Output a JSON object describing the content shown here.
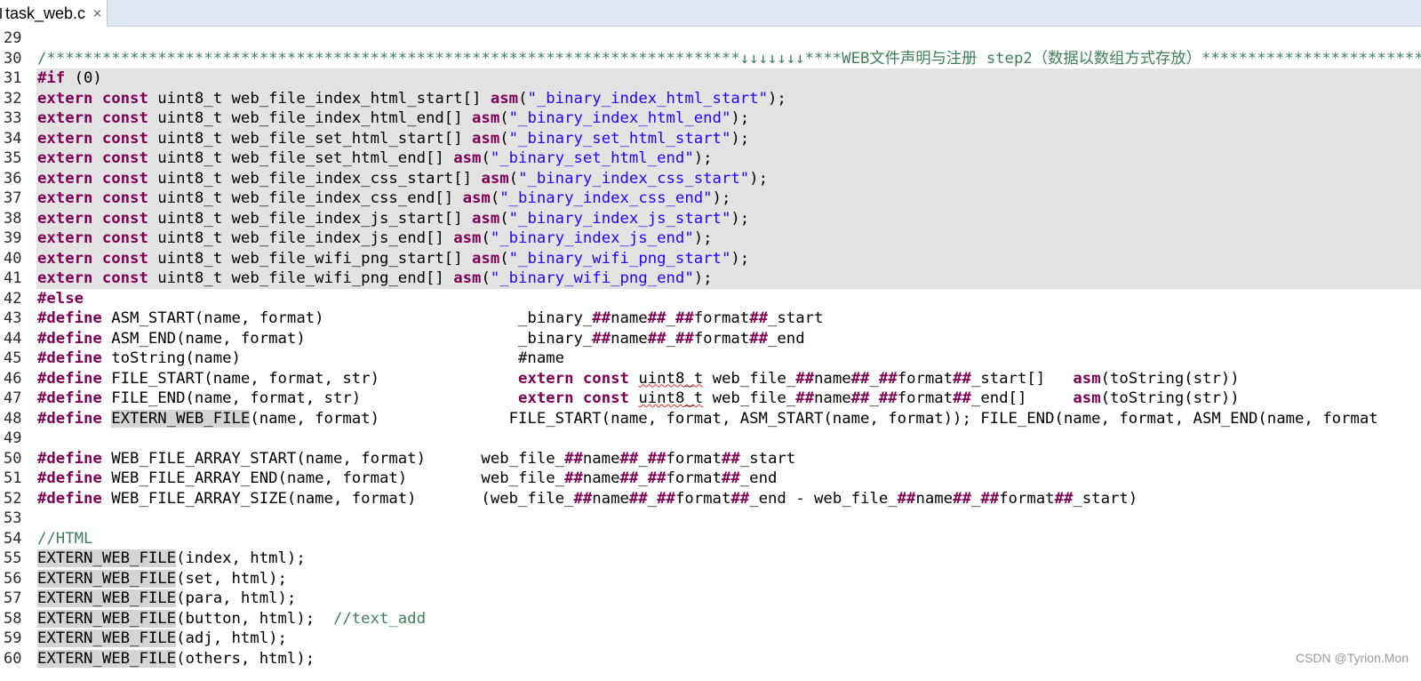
{
  "tab": {
    "title": "task_web.c",
    "close_glyph": "×"
  },
  "lines": [
    {
      "n": "29",
      "hl": false,
      "tokens": []
    },
    {
      "n": "30",
      "hl": false,
      "tokens": [
        {
          "t": "/***************************************************************************↓↓↓↓↓↓↓****WEB文件声明与注册 step2（数据以数组方式存放）******************************",
          "c": "cmt"
        }
      ]
    },
    {
      "n": "31",
      "hl": true,
      "tokens": [
        {
          "t": "#if",
          "c": "pp"
        },
        {
          "t": " (0)"
        }
      ]
    },
    {
      "n": "32",
      "hl": true,
      "tokens": [
        {
          "t": "extern",
          "c": "kw"
        },
        {
          "t": " "
        },
        {
          "t": "const",
          "c": "kw"
        },
        {
          "t": " uint8_t web_file_index_html_start[] "
        },
        {
          "t": "asm",
          "c": "kw"
        },
        {
          "t": "("
        },
        {
          "t": "\"_binary_index_html_start\"",
          "c": "str"
        },
        {
          "t": ");"
        }
      ]
    },
    {
      "n": "33",
      "hl": true,
      "tokens": [
        {
          "t": "extern",
          "c": "kw"
        },
        {
          "t": " "
        },
        {
          "t": "const",
          "c": "kw"
        },
        {
          "t": " uint8_t web_file_index_html_end[] "
        },
        {
          "t": "asm",
          "c": "kw"
        },
        {
          "t": "("
        },
        {
          "t": "\"_binary_index_html_end\"",
          "c": "str"
        },
        {
          "t": ");"
        }
      ]
    },
    {
      "n": "34",
      "hl": true,
      "tokens": [
        {
          "t": "extern",
          "c": "kw"
        },
        {
          "t": " "
        },
        {
          "t": "const",
          "c": "kw"
        },
        {
          "t": " uint8_t web_file_set_html_start[] "
        },
        {
          "t": "asm",
          "c": "kw"
        },
        {
          "t": "("
        },
        {
          "t": "\"_binary_set_html_start\"",
          "c": "str"
        },
        {
          "t": ");"
        }
      ]
    },
    {
      "n": "35",
      "hl": true,
      "tokens": [
        {
          "t": "extern",
          "c": "kw"
        },
        {
          "t": " "
        },
        {
          "t": "const",
          "c": "kw"
        },
        {
          "t": " uint8_t web_file_set_html_end[] "
        },
        {
          "t": "asm",
          "c": "kw"
        },
        {
          "t": "("
        },
        {
          "t": "\"_binary_set_html_end\"",
          "c": "str"
        },
        {
          "t": ");"
        }
      ]
    },
    {
      "n": "36",
      "hl": true,
      "tokens": [
        {
          "t": "extern",
          "c": "kw"
        },
        {
          "t": " "
        },
        {
          "t": "const",
          "c": "kw"
        },
        {
          "t": " uint8_t web_file_index_css_start[] "
        },
        {
          "t": "asm",
          "c": "kw"
        },
        {
          "t": "("
        },
        {
          "t": "\"_binary_index_css_start\"",
          "c": "str"
        },
        {
          "t": ");"
        }
      ]
    },
    {
      "n": "37",
      "hl": true,
      "tokens": [
        {
          "t": "extern",
          "c": "kw"
        },
        {
          "t": " "
        },
        {
          "t": "const",
          "c": "kw"
        },
        {
          "t": " uint8_t web_file_index_css_end[] "
        },
        {
          "t": "asm",
          "c": "kw"
        },
        {
          "t": "("
        },
        {
          "t": "\"_binary_index_css_end\"",
          "c": "str"
        },
        {
          "t": ");"
        }
      ]
    },
    {
      "n": "38",
      "hl": true,
      "tokens": [
        {
          "t": "extern",
          "c": "kw"
        },
        {
          "t": " "
        },
        {
          "t": "const",
          "c": "kw"
        },
        {
          "t": " uint8_t web_file_index_js_start[] "
        },
        {
          "t": "asm",
          "c": "kw"
        },
        {
          "t": "("
        },
        {
          "t": "\"_binary_index_js_start\"",
          "c": "str"
        },
        {
          "t": ");"
        }
      ]
    },
    {
      "n": "39",
      "hl": true,
      "tokens": [
        {
          "t": "extern",
          "c": "kw"
        },
        {
          "t": " "
        },
        {
          "t": "const",
          "c": "kw"
        },
        {
          "t": " uint8_t web_file_index_js_end[] "
        },
        {
          "t": "asm",
          "c": "kw"
        },
        {
          "t": "("
        },
        {
          "t": "\"_binary_index_js_end\"",
          "c": "str"
        },
        {
          "t": ");"
        }
      ]
    },
    {
      "n": "40",
      "hl": true,
      "tokens": [
        {
          "t": "extern",
          "c": "kw"
        },
        {
          "t": " "
        },
        {
          "t": "const",
          "c": "kw"
        },
        {
          "t": " uint8_t web_file_wifi_png_start[] "
        },
        {
          "t": "asm",
          "c": "kw"
        },
        {
          "t": "("
        },
        {
          "t": "\"_binary_wifi_png_start\"",
          "c": "str"
        },
        {
          "t": ");"
        }
      ]
    },
    {
      "n": "41",
      "hl": true,
      "tokens": [
        {
          "t": "extern",
          "c": "kw"
        },
        {
          "t": " "
        },
        {
          "t": "const",
          "c": "kw"
        },
        {
          "t": " uint8_t web_file_wifi_png_end[] "
        },
        {
          "t": "asm",
          "c": "kw"
        },
        {
          "t": "("
        },
        {
          "t": "\"_binary_wifi_png_end\"",
          "c": "str"
        },
        {
          "t": ");"
        }
      ]
    },
    {
      "n": "42",
      "hl": false,
      "tokens": [
        {
          "t": "#else",
          "c": "pp"
        }
      ]
    },
    {
      "n": "43",
      "hl": false,
      "tokens": [
        {
          "t": "#define",
          "c": "pp"
        },
        {
          "t": " ASM_START(name, format)                     _binary_"
        },
        {
          "t": "##",
          "c": "kw"
        },
        {
          "t": "name"
        },
        {
          "t": "##",
          "c": "kw"
        },
        {
          "t": "_"
        },
        {
          "t": "##",
          "c": "kw"
        },
        {
          "t": "format"
        },
        {
          "t": "##",
          "c": "kw"
        },
        {
          "t": "_start"
        }
      ]
    },
    {
      "n": "44",
      "hl": false,
      "tokens": [
        {
          "t": "#define",
          "c": "pp"
        },
        {
          "t": " ASM_END(name, format)                       _binary_"
        },
        {
          "t": "##",
          "c": "kw"
        },
        {
          "t": "name"
        },
        {
          "t": "##",
          "c": "kw"
        },
        {
          "t": "_"
        },
        {
          "t": "##",
          "c": "kw"
        },
        {
          "t": "format"
        },
        {
          "t": "##",
          "c": "kw"
        },
        {
          "t": "_end"
        }
      ]
    },
    {
      "n": "45",
      "hl": false,
      "tokens": [
        {
          "t": "#define",
          "c": "pp"
        },
        {
          "t": " toString(name)                              #name"
        }
      ]
    },
    {
      "n": "46",
      "hl": false,
      "tokens": [
        {
          "t": "#define",
          "c": "pp"
        },
        {
          "t": " FILE_START(name, format, str)               "
        },
        {
          "t": "extern",
          "c": "kw"
        },
        {
          "t": " "
        },
        {
          "t": "const",
          "c": "kw"
        },
        {
          "t": " "
        },
        {
          "t": "uint8_t",
          "c": "sq"
        },
        {
          "t": " web_file_"
        },
        {
          "t": "##",
          "c": "kw"
        },
        {
          "t": "name"
        },
        {
          "t": "##",
          "c": "kw"
        },
        {
          "t": "_"
        },
        {
          "t": "##",
          "c": "kw"
        },
        {
          "t": "format"
        },
        {
          "t": "##",
          "c": "kw"
        },
        {
          "t": "_start[]   "
        },
        {
          "t": "asm",
          "c": "kw"
        },
        {
          "t": "(toString(str))"
        }
      ]
    },
    {
      "n": "47",
      "hl": false,
      "tokens": [
        {
          "t": "#define",
          "c": "pp"
        },
        {
          "t": " FILE_END(name, format, str)                 "
        },
        {
          "t": "extern",
          "c": "kw"
        },
        {
          "t": " "
        },
        {
          "t": "const",
          "c": "kw"
        },
        {
          "t": " "
        },
        {
          "t": "uint8_t",
          "c": "sq"
        },
        {
          "t": " web_file_"
        },
        {
          "t": "##",
          "c": "kw"
        },
        {
          "t": "name"
        },
        {
          "t": "##",
          "c": "kw"
        },
        {
          "t": "_"
        },
        {
          "t": "##",
          "c": "kw"
        },
        {
          "t": "format"
        },
        {
          "t": "##",
          "c": "kw"
        },
        {
          "t": "_end[]     "
        },
        {
          "t": "asm",
          "c": "kw"
        },
        {
          "t": "(toString(str))"
        }
      ]
    },
    {
      "n": "48",
      "hl": false,
      "tokens": [
        {
          "t": "#define",
          "c": "pp"
        },
        {
          "t": " "
        },
        {
          "t": "EXTERN_WEB_FILE",
          "c": "mark"
        },
        {
          "t": "(name, format)              FILE_START(name, format, ASM_START(name, format)); FILE_END(name, format, ASM_END(name, format"
        }
      ]
    },
    {
      "n": "49",
      "hl": false,
      "tokens": []
    },
    {
      "n": "50",
      "hl": false,
      "tokens": [
        {
          "t": "#define",
          "c": "pp"
        },
        {
          "t": " WEB_FILE_ARRAY_START(name, format)      web_file_"
        },
        {
          "t": "##",
          "c": "kw"
        },
        {
          "t": "name"
        },
        {
          "t": "##",
          "c": "kw"
        },
        {
          "t": "_"
        },
        {
          "t": "##",
          "c": "kw"
        },
        {
          "t": "format"
        },
        {
          "t": "##",
          "c": "kw"
        },
        {
          "t": "_start"
        }
      ]
    },
    {
      "n": "51",
      "hl": false,
      "tokens": [
        {
          "t": "#define",
          "c": "pp"
        },
        {
          "t": " WEB_FILE_ARRAY_END(name, format)        web_file_"
        },
        {
          "t": "##",
          "c": "kw"
        },
        {
          "t": "name"
        },
        {
          "t": "##",
          "c": "kw"
        },
        {
          "t": "_"
        },
        {
          "t": "##",
          "c": "kw"
        },
        {
          "t": "format"
        },
        {
          "t": "##",
          "c": "kw"
        },
        {
          "t": "_end"
        }
      ]
    },
    {
      "n": "52",
      "hl": false,
      "tokens": [
        {
          "t": "#define",
          "c": "pp"
        },
        {
          "t": " WEB_FILE_ARRAY_SIZE(name, format)       (web_file_"
        },
        {
          "t": "##",
          "c": "kw"
        },
        {
          "t": "name"
        },
        {
          "t": "##",
          "c": "kw"
        },
        {
          "t": "_"
        },
        {
          "t": "##",
          "c": "kw"
        },
        {
          "t": "format"
        },
        {
          "t": "##",
          "c": "kw"
        },
        {
          "t": "_end - web_file_"
        },
        {
          "t": "##",
          "c": "kw"
        },
        {
          "t": "name"
        },
        {
          "t": "##",
          "c": "kw"
        },
        {
          "t": "_"
        },
        {
          "t": "##",
          "c": "kw"
        },
        {
          "t": "format"
        },
        {
          "t": "##",
          "c": "kw"
        },
        {
          "t": "_start)"
        }
      ]
    },
    {
      "n": "53",
      "hl": false,
      "tokens": []
    },
    {
      "n": "54",
      "hl": false,
      "tokens": [
        {
          "t": "//HTML",
          "c": "cmt"
        }
      ]
    },
    {
      "n": "55",
      "hl": false,
      "tokens": [
        {
          "t": "EXTERN_WEB_FILE",
          "c": "mark"
        },
        {
          "t": "(index, html);"
        }
      ]
    },
    {
      "n": "56",
      "hl": false,
      "tokens": [
        {
          "t": "EXTERN_WEB_FILE",
          "c": "mark"
        },
        {
          "t": "(set, html);"
        }
      ]
    },
    {
      "n": "57",
      "hl": false,
      "tokens": [
        {
          "t": "EXTERN_WEB_FILE",
          "c": "mark"
        },
        {
          "t": "(para, html);"
        }
      ]
    },
    {
      "n": "58",
      "hl": false,
      "tokens": [
        {
          "t": "EXTERN_WEB_FILE",
          "c": "mark"
        },
        {
          "t": "(button, html);  "
        },
        {
          "t": "//text_add",
          "c": "cmt"
        }
      ]
    },
    {
      "n": "59",
      "hl": false,
      "tokens": [
        {
          "t": "EXTERN_WEB_FILE",
          "c": "mark"
        },
        {
          "t": "(adj, html);"
        }
      ]
    },
    {
      "n": "60",
      "hl": false,
      "tokens": [
        {
          "t": "EXTERN_WEB_FILE",
          "c": "mark"
        },
        {
          "t": "(others, html);"
        }
      ]
    }
  ],
  "watermark": "CSDN @Tyrion.Mon",
  "colors": {
    "keyword": "#7f0055",
    "string": "#2a00ff",
    "comment": "#3f7f5f",
    "highlight": "#e3e3e3",
    "tabbar": "#dfe8f2"
  }
}
